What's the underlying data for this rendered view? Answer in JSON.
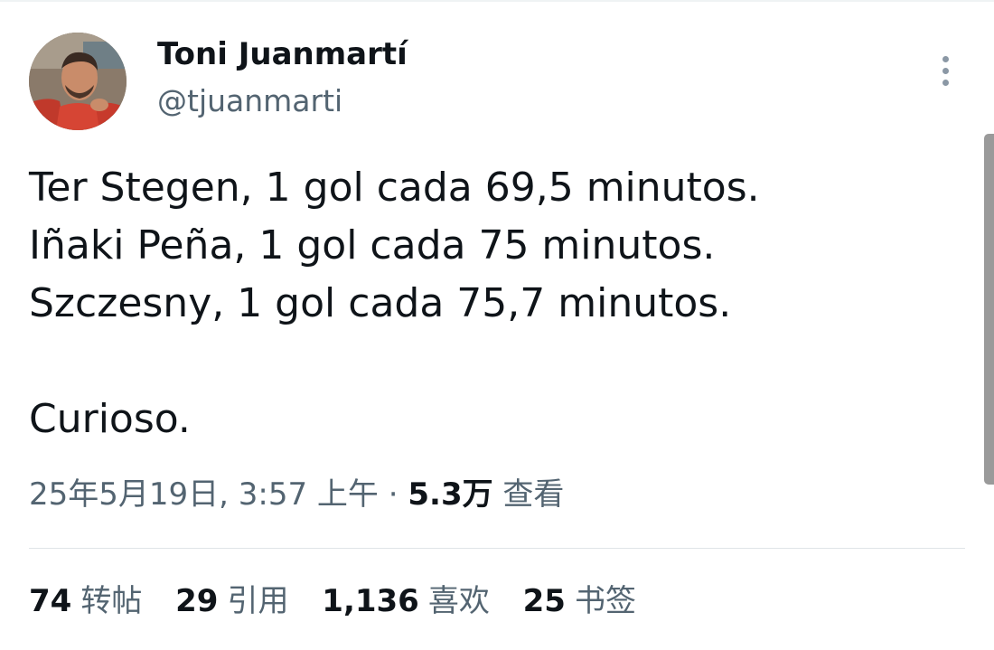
{
  "author": {
    "name": "Toni Juanmartí",
    "handle": "@tjuanmarti"
  },
  "tweet": {
    "lines": [
      "Ter Stegen, 1 gol cada 69,5 minutos.",
      "Iñaki Peña, 1 gol cada 75 minutos.",
      "Szczesny, 1 gol cada 75,7 minutos.",
      "",
      "Curioso."
    ]
  },
  "meta": {
    "timestamp": "25年5月19日, 3:57 上午",
    "separator": "·",
    "views_count": "5.3万",
    "views_label": "查看"
  },
  "stats": [
    {
      "count": "74",
      "label": "转帖"
    },
    {
      "count": "29",
      "label": "引用"
    },
    {
      "count": "1,136",
      "label": "喜欢"
    },
    {
      "count": "25",
      "label": "书签"
    }
  ],
  "icons": {
    "more": "more-vertical-icon"
  },
  "colors": {
    "primary_text": "#0f1419",
    "secondary_text": "#536471",
    "divider": "#dfe4e7"
  }
}
